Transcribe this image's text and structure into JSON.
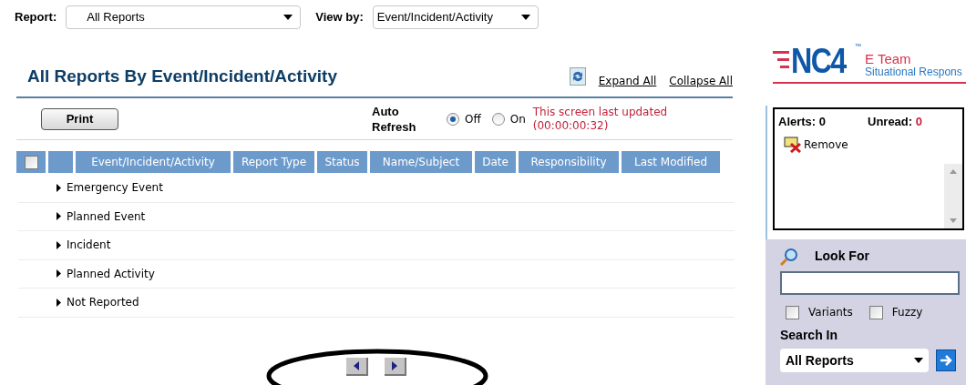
{
  "filters": {
    "report_label": "Report:",
    "report_value": "All Reports",
    "viewby_label": "View by:",
    "viewby_value": "Event/Incident/Activity"
  },
  "title": "All Reports By Event/Incident/Activity",
  "links": [
    "Expand All",
    "Collapse All"
  ],
  "toolbar": {
    "print": "Print",
    "auto_refresh_label": "Auto Refresh",
    "options": [
      {
        "label": "Off",
        "selected": true
      },
      {
        "label": "On",
        "selected": false
      }
    ],
    "updated": "This screen last updated",
    "elapsed": "(00:00:00:32)"
  },
  "table": {
    "select_all": {
      "checked": false
    },
    "columns": [
      "Event/Incident/Activity",
      "Report Type",
      "Status",
      "Name/Subject",
      "Date",
      "Responsibility",
      "Last Modified"
    ],
    "groups": [
      {
        "label": "Emergency Event",
        "expanded": false
      },
      {
        "label": "Planned Event",
        "expanded": false
      },
      {
        "label": "Incident",
        "expanded": false
      },
      {
        "label": "Planned Activity",
        "expanded": false
      },
      {
        "label": "Not Reported",
        "expanded": false
      }
    ]
  },
  "logo": {
    "mark": "NC4",
    "tm": "™",
    "line1": "E Team",
    "line2": "Situational Respons"
  },
  "alerts": {
    "alerts_label": "Alerts:",
    "alerts_count": "0",
    "unread_label": "Unread:",
    "unread_count": "0",
    "remove": "Remove"
  },
  "search": {
    "title": "Look For",
    "options": [
      {
        "label": "Variants",
        "checked": false
      },
      {
        "label": "Fuzzy",
        "checked": false
      }
    ],
    "search_in_label": "Search In",
    "search_in_value": "All Reports"
  }
}
